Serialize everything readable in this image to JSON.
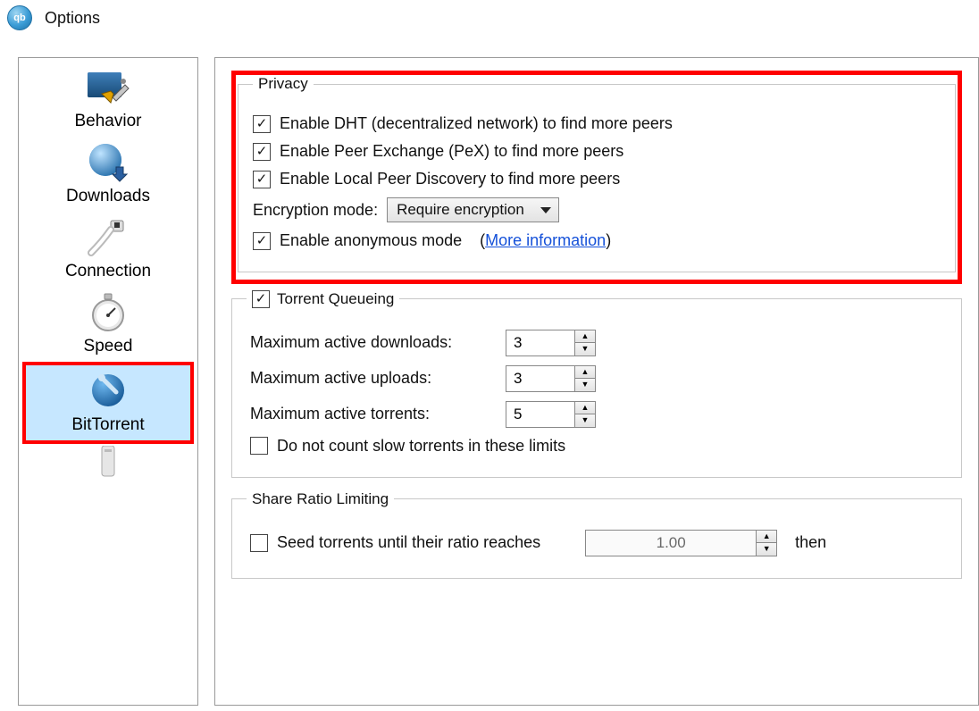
{
  "window": {
    "title": "Options"
  },
  "sidebar": {
    "items": [
      {
        "label": "Behavior"
      },
      {
        "label": "Downloads"
      },
      {
        "label": "Connection"
      },
      {
        "label": "Speed"
      },
      {
        "label": "BitTorrent"
      }
    ]
  },
  "privacy": {
    "legend": "Privacy",
    "dht_label": "Enable DHT (decentralized network) to find more peers",
    "pex_label": "Enable Peer Exchange (PeX) to find more peers",
    "lpd_label": "Enable Local Peer Discovery to find more peers",
    "enc_label": "Encryption mode:",
    "enc_value": "Require encryption",
    "anon_label": "Enable anonymous mode",
    "more_info": "More information",
    "dht_checked": true,
    "pex_checked": true,
    "lpd_checked": true,
    "anon_checked": true
  },
  "queueing": {
    "enabled": true,
    "legend": "Torrent Queueing",
    "max_dl_label": "Maximum active downloads:",
    "max_dl_value": "3",
    "max_ul_label": "Maximum active uploads:",
    "max_ul_value": "3",
    "max_tr_label": "Maximum active torrents:",
    "max_tr_value": "5",
    "slow_label": "Do not count slow torrents in these limits",
    "slow_checked": false
  },
  "ratio": {
    "legend": "Share Ratio Limiting",
    "seed_label": "Seed torrents until their ratio reaches",
    "seed_checked": false,
    "seed_value": "1.00",
    "then_label": "then"
  }
}
